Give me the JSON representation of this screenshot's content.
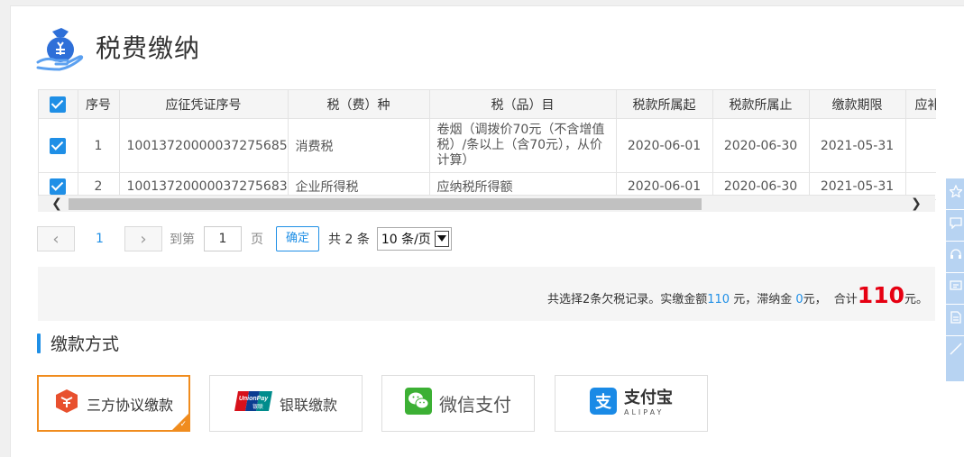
{
  "page": {
    "title": "税费缴纳"
  },
  "table": {
    "headers": [
      "序号",
      "应征凭证序号",
      "税（费）种",
      "税（品）目",
      "税款所属起",
      "税款所属止",
      "缴款期限",
      "应补"
    ],
    "rows": [
      {
        "index": "1",
        "voucher": "10013720000037275685",
        "tax_type": "消费税",
        "tax_item": "卷烟（调拨价70元（不含增值税）/条以上（含70元），从价计算）",
        "start": "2020-06-01",
        "end": "2020-06-30",
        "deadline": "2021-05-31",
        "checked": true
      },
      {
        "index": "2",
        "voucher": "10013720000037275683",
        "tax_type": "企业所得税",
        "tax_item": "应纳税所得额",
        "start": "2020-06-01",
        "end": "2020-06-30",
        "deadline": "2021-05-31",
        "checked": true
      }
    ],
    "header_checked": true
  },
  "pager": {
    "current_page": "1",
    "goto_label": "到第",
    "goto_value": "1",
    "page_label": "页",
    "confirm_label": "确定",
    "total_label": "共 2 条",
    "page_size": "10 条/页"
  },
  "summary": {
    "prefix": "共选择2条欠税记录。实缴金额",
    "paid_amount": "110",
    "paid_unit": " 元，滞纳金 ",
    "late_fee": "0",
    "late_unit": "元，",
    "total_label": "合计",
    "total_amount": "110",
    "total_unit": "元。"
  },
  "payment": {
    "section_title": "缴款方式",
    "methods": [
      {
        "label": "三方协议缴款",
        "icon": "tripartite-agreement-icon",
        "selected": true
      },
      {
        "label": "银联缴款",
        "icon": "unionpay-icon",
        "logo_text": "UnionPay 银联",
        "selected": false
      },
      {
        "label": "微信支付",
        "icon": "wechat-icon",
        "selected": false
      },
      {
        "label": "支付宝",
        "sublabel": "ALIPAY",
        "icon": "alipay-icon",
        "selected": false
      }
    ]
  },
  "colors": {
    "accent": "#1f8fe6",
    "selected_border": "#f08c1e",
    "total_red": "#e60012",
    "float_bg": "#b7d3f2"
  },
  "float_toolbar": [
    "star-icon",
    "chat-icon",
    "headset-icon",
    "message-icon",
    "document-icon",
    "top-icon"
  ]
}
